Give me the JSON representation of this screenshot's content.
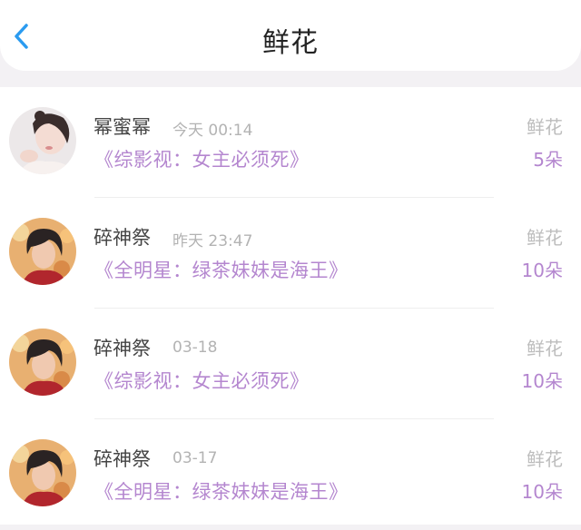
{
  "header": {
    "title": "鲜花",
    "back_icon": "chevron-left-icon",
    "accent_color": "#2a9bf0"
  },
  "records": [
    {
      "avatar": "female-avatar",
      "user": "幂蜜幂",
      "time": "今天 00:14",
      "book": "《综影视：女主必须死》",
      "gift_type": "鲜花",
      "count": "5朵"
    },
    {
      "avatar": "male-avatar",
      "user": "碎神祭",
      "time": "昨天 23:47",
      "book": "《全明星：绿茶妹妹是海王》",
      "gift_type": "鲜花",
      "count": "10朵"
    },
    {
      "avatar": "male-avatar",
      "user": "碎神祭",
      "time": "03-18",
      "book": "《综影视：女主必须死》",
      "gift_type": "鲜花",
      "count": "10朵"
    },
    {
      "avatar": "male-avatar",
      "user": "碎神祭",
      "time": "03-17",
      "book": "《全明星：绿茶妹妹是海王》",
      "gift_type": "鲜花",
      "count": "10朵"
    }
  ]
}
